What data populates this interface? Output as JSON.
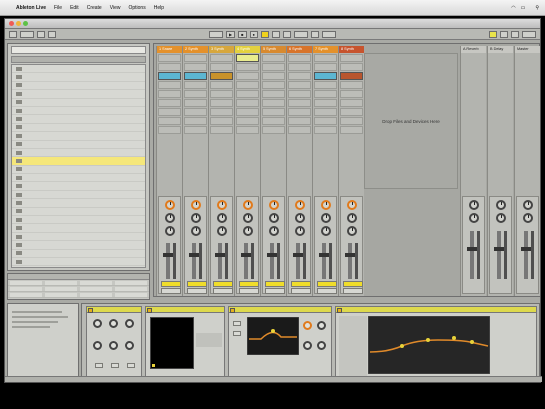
{
  "menubar": {
    "app_name": "Ableton Live",
    "items": [
      "File",
      "Edit",
      "Create",
      "View",
      "Options",
      "Help"
    ]
  },
  "window": {
    "title": ""
  },
  "browser": {
    "rows": [
      {
        "label": "",
        "selected": false
      },
      {
        "label": "",
        "selected": false
      },
      {
        "label": "",
        "selected": false
      },
      {
        "label": "",
        "selected": false
      },
      {
        "label": "",
        "selected": false
      },
      {
        "label": "",
        "selected": false
      },
      {
        "label": "",
        "selected": false
      },
      {
        "label": "",
        "selected": false
      },
      {
        "label": "",
        "selected": false
      },
      {
        "label": "",
        "selected": false
      },
      {
        "label": "",
        "selected": false
      },
      {
        "label": "",
        "selected": true
      },
      {
        "label": "",
        "selected": false
      },
      {
        "label": "",
        "selected": false
      },
      {
        "label": "",
        "selected": false
      },
      {
        "label": "",
        "selected": false
      },
      {
        "label": "",
        "selected": false
      },
      {
        "label": "",
        "selected": false
      },
      {
        "label": "",
        "selected": false
      },
      {
        "label": "",
        "selected": false
      },
      {
        "label": "",
        "selected": false
      },
      {
        "label": "",
        "selected": false
      },
      {
        "label": "",
        "selected": false
      },
      {
        "label": "",
        "selected": false
      }
    ]
  },
  "groove_pool": {
    "title": ""
  },
  "info_view": {
    "title": ""
  },
  "session": {
    "tracks": [
      {
        "name": "1 Snare",
        "color": "#e4912b",
        "clips": [
          "",
          "",
          "#5cb6d2",
          "",
          "",
          "",
          "",
          "",
          ""
        ]
      },
      {
        "name": "2 Synth",
        "color": "#e4912b",
        "clips": [
          "",
          "",
          "#5cb6d2",
          "",
          "",
          "",
          "",
          "",
          ""
        ]
      },
      {
        "name": "3 Synth",
        "color": "#d7a73c",
        "clips": [
          "",
          "",
          "#c8922a",
          "",
          "",
          "",
          "",
          "",
          ""
        ]
      },
      {
        "name": "4 Synth",
        "color": "#e3d13e",
        "clips": [
          "#e9ec8e",
          "",
          "",
          "",
          "",
          "",
          "",
          "",
          ""
        ]
      },
      {
        "name": "5 Synth",
        "color": "#d88a2f",
        "clips": [
          "",
          "",
          "",
          "",
          "",
          "",
          "",
          "",
          ""
        ]
      },
      {
        "name": "6 Synth",
        "color": "#d8742a",
        "clips": [
          "",
          "",
          "",
          "",
          "",
          "",
          "",
          "",
          ""
        ]
      },
      {
        "name": "7 Synth",
        "color": "#e4912b",
        "clips": [
          "",
          "",
          "#5cb6d2",
          "",
          "",
          "",
          "",
          "",
          ""
        ]
      },
      {
        "name": "8 Synth",
        "color": "#c7542e",
        "clips": [
          "",
          "",
          "#b8552d",
          "",
          "",
          "",
          "",
          "",
          ""
        ]
      }
    ],
    "returns": [
      {
        "name": "A Reverb",
        "color": "#c7c7c2"
      },
      {
        "name": "B Delay",
        "color": "#c7c7c2"
      }
    ],
    "master": {
      "name": "Master",
      "color": "#c7c7c2"
    },
    "drop_hint": "Drop Files and Devices Here"
  },
  "devices": {
    "items": [
      {
        "name": ""
      },
      {
        "name": ""
      },
      {
        "name": ""
      },
      {
        "name": ""
      }
    ],
    "drop_hint": ""
  }
}
